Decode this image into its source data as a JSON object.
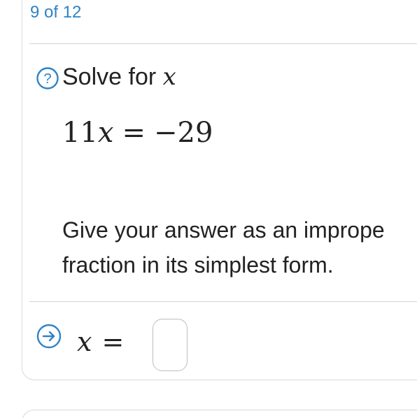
{
  "header": {
    "progress_label": "9 of 12"
  },
  "question": {
    "prompt_text": "Solve for ",
    "prompt_variable": "x",
    "equation": {
      "coefficient": "11",
      "variable": "x",
      "operator": "=",
      "rhs": "−29"
    },
    "instruction_line1": "Give your answer as an imprope",
    "instruction_line2": "fraction in its simplest form."
  },
  "answer": {
    "variable": "x",
    "operator": "=",
    "value": ""
  },
  "icons": {
    "help": "question-circle-icon",
    "submit": "arrow-right-circle-icon"
  },
  "colors": {
    "accent": "#2f83c5",
    "border": "#d9d9d9"
  }
}
